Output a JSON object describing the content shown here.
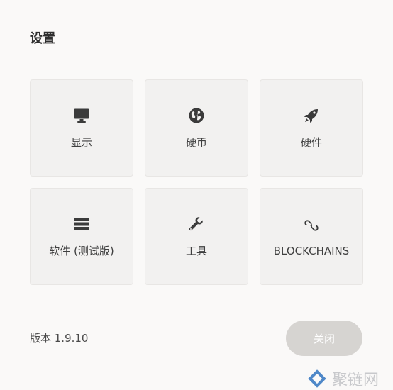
{
  "dialog": {
    "title": "设置",
    "version": "版本 1.9.10",
    "close_label": "关闭"
  },
  "tiles": [
    {
      "label": "显示",
      "icon": "monitor-icon"
    },
    {
      "label": "硬币",
      "icon": "globe-icon"
    },
    {
      "label": "硬件",
      "icon": "rocket-icon"
    },
    {
      "label": "软件 (测试版)",
      "icon": "grid-icon"
    },
    {
      "label": "工具",
      "icon": "wrench-icon"
    },
    {
      "label": "BLOCKCHAINS",
      "icon": "link-icon"
    }
  ],
  "watermark": {
    "text": "聚链网"
  },
  "colors": {
    "background": "#faf9f8",
    "tile": "#f2f1f0",
    "close_button": "#d6d4d1",
    "watermark_accent": "#4f88c8"
  }
}
